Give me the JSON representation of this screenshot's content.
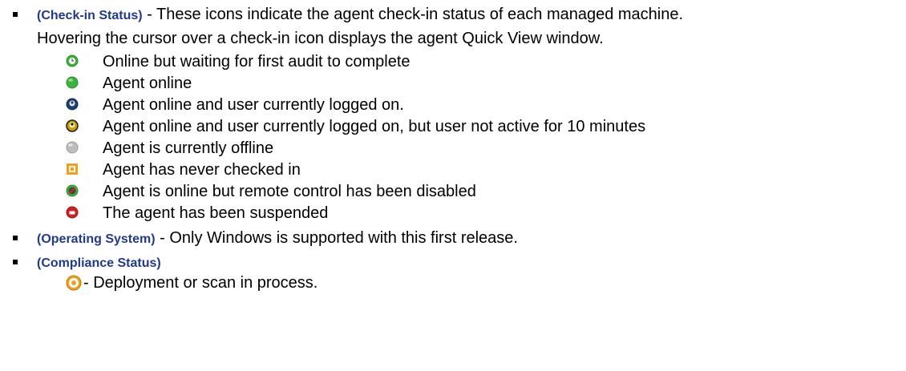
{
  "sections": {
    "checkin": {
      "label": "(Check-in Status)",
      "description_line1": " - These icons indicate the agent check-in status of each managed machine.",
      "description_line2": "Hovering the cursor over a check-in icon displays the agent Quick View window.",
      "items": [
        {
          "icon": "online-waiting-audit-icon",
          "text": "Online but waiting for first audit to complete"
        },
        {
          "icon": "agent-online-icon",
          "text": "Agent online"
        },
        {
          "icon": "user-logged-on-icon",
          "text": "Agent online and user currently logged on."
        },
        {
          "icon": "user-inactive-icon",
          "text": "Agent online and user currently logged on, but user not active for 10 minutes"
        },
        {
          "icon": "agent-offline-icon",
          "text": "Agent is currently offline"
        },
        {
          "icon": "never-checked-in-icon",
          "text": "Agent has never checked in"
        },
        {
          "icon": "remote-control-disabled-icon",
          "text": "Agent is online but remote control has been disabled"
        },
        {
          "icon": "agent-suspended-icon",
          "text": "The agent has been suspended"
        }
      ]
    },
    "os": {
      "label": "(Operating System)",
      "description": " - Only Windows is supported with this first release."
    },
    "compliance": {
      "label": "(Compliance Status)",
      "items": [
        {
          "icon": "deployment-in-process-icon",
          "text": " - Deployment or scan in process."
        }
      ]
    }
  },
  "colors": {
    "label": "#1f3a8a",
    "online_green": "#3bb33b",
    "offline_gray": "#bdbdbd",
    "never_orange": "#f0a020",
    "suspended_red": "#d22020"
  }
}
